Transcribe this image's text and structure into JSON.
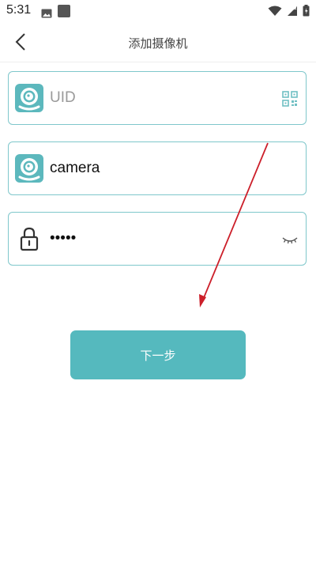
{
  "status_bar": {
    "time": "5:31"
  },
  "header": {
    "title": "添加摄像机"
  },
  "form": {
    "uid": {
      "value": "",
      "placeholder": "UID"
    },
    "name": {
      "value": "camera",
      "placeholder": ""
    },
    "password": {
      "value": "12345",
      "placeholder": ""
    }
  },
  "next_button": {
    "label": "下一步"
  },
  "colors": {
    "accent": "#55b9be",
    "field_border": "#7fc7cb",
    "annotation": "#cc1f2a"
  }
}
